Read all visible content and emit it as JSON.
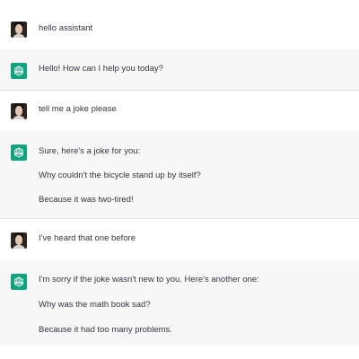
{
  "conversation": {
    "messages": [
      {
        "role": "user",
        "lines": [
          "hello assistant"
        ]
      },
      {
        "role": "assistant",
        "lines": [
          "Hello! How can I help you today?"
        ]
      },
      {
        "role": "user",
        "lines": [
          "tell me a joke please"
        ]
      },
      {
        "role": "assistant",
        "lines": [
          "Sure, here's a joke for you:",
          "Why couldn't the bicycle stand up by itself?",
          "Because it was two-tired!"
        ]
      },
      {
        "role": "user",
        "lines": [
          "I've heard that one before"
        ]
      },
      {
        "role": "assistant",
        "lines": [
          "I'm sorry if the joke wasn't new to you. Here's another one:",
          "Why was the math book sad?",
          "Because it had too many problems."
        ]
      }
    ]
  },
  "icons": {
    "user_avatar": "user-avatar-photo",
    "assistant_avatar": "openai-logo-icon"
  },
  "colors": {
    "assistant_background": "#f7f7f8",
    "user_background": "#ffffff",
    "assistant_avatar_bg": "#10a37f",
    "text": "#343541"
  }
}
